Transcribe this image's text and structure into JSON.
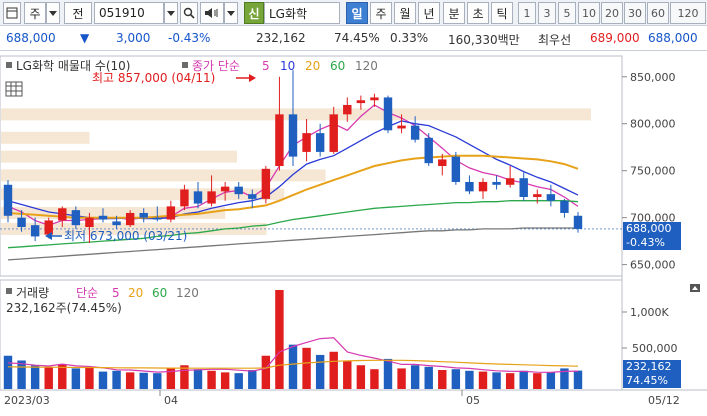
{
  "toolbar": {
    "chart_type": "주",
    "prev_label": "전",
    "code": "051910",
    "new_badge": "신",
    "stock_name": "LG화학",
    "periods": [
      "일",
      "주",
      "월",
      "년",
      "분",
      "초",
      "틱"
    ],
    "selected_period": "일",
    "intervals": [
      "1",
      "3",
      "5",
      "10",
      "20",
      "30",
      "60",
      "120"
    ]
  },
  "quote": {
    "price": "688,000",
    "direction": "▼",
    "change": "3,000",
    "change_pct": "-0.43%",
    "volume": "232,162",
    "volume_ratio": "74.45%",
    "turnover_pct": "0.33%",
    "amount": "160,330백만",
    "best_ask_label": "최우선",
    "ask": "689,000",
    "bid": "688,000"
  },
  "price_pane": {
    "title": "LG화학 매물대 수(10)",
    "ma_label": "종가 단순",
    "ma_periods": [
      "5",
      "10",
      "20",
      "60",
      "120"
    ],
    "ma_colors": [
      "#d63ab0",
      "#2a3ad6",
      "#e7a21a",
      "#2aa84a",
      "#777777"
    ],
    "high_note": "최고 857,000 (04/11)",
    "low_note": "최저 673,000 (03/21)",
    "y_ticks": [
      "850,000",
      "800,000",
      "750,000",
      "700,000",
      "650,000"
    ],
    "current_badge": "688,000",
    "current_pct": "-0.43%"
  },
  "volume_pane": {
    "title": "거래량",
    "ma_label": "단순",
    "ma_periods": [
      "5",
      "20",
      "60",
      "120"
    ],
    "ma_colors": [
      "#d63ab0",
      "#e7a21a",
      "#2aa84a",
      "#777777"
    ],
    "summary": "232,162주(74.45%)",
    "y_ticks": [
      "1,000K",
      "500,000"
    ],
    "current_badge": "232,162",
    "current_pct": "74.45%"
  },
  "dates": {
    "left": "2023/03",
    "mid1": "04",
    "mid2": "05",
    "right": "05/12"
  },
  "chart_data": {
    "type": "candlestick",
    "title": "LG화학",
    "price_ylim": [
      640000,
      870000
    ],
    "volume_ylim": [
      0,
      1250000
    ],
    "colors": {
      "up": "#e01e1e",
      "down": "#1f5fbf"
    },
    "candles": [
      {
        "date": "03/13",
        "open": 735000,
        "high": 740000,
        "low": 695000,
        "close": 702000,
        "volume": 420000
      },
      {
        "date": "03/14",
        "open": 700000,
        "high": 708000,
        "low": 685000,
        "close": 690000,
        "volume": 360000
      },
      {
        "date": "03/15",
        "open": 692000,
        "high": 700000,
        "low": 675000,
        "close": 680000,
        "volume": 300000
      },
      {
        "date": "03/16",
        "open": 682000,
        "high": 700000,
        "low": 678000,
        "close": 697000,
        "volume": 280000
      },
      {
        "date": "03/17",
        "open": 697000,
        "high": 712000,
        "low": 690000,
        "close": 710000,
        "volume": 310000
      },
      {
        "date": "03/20",
        "open": 708000,
        "high": 712000,
        "low": 688000,
        "close": 692000,
        "volume": 260000
      },
      {
        "date": "03/21",
        "open": 690000,
        "high": 705000,
        "low": 673000,
        "close": 700000,
        "volume": 270000
      },
      {
        "date": "03/22",
        "open": 702000,
        "high": 710000,
        "low": 695000,
        "close": 698000,
        "volume": 220000
      },
      {
        "date": "03/23",
        "open": 696000,
        "high": 702000,
        "low": 688000,
        "close": 692000,
        "volume": 230000
      },
      {
        "date": "03/24",
        "open": 692000,
        "high": 708000,
        "low": 690000,
        "close": 705000,
        "volume": 210000
      },
      {
        "date": "03/27",
        "open": 705000,
        "high": 710000,
        "low": 695000,
        "close": 700000,
        "volume": 205000
      },
      {
        "date": "03/28",
        "open": 700000,
        "high": 712000,
        "low": 696000,
        "close": 698000,
        "volume": 200000
      },
      {
        "date": "03/29",
        "open": 698000,
        "high": 718000,
        "low": 695000,
        "close": 712000,
        "volume": 260000
      },
      {
        "date": "03/30",
        "open": 712000,
        "high": 735000,
        "low": 708000,
        "close": 730000,
        "volume": 300000
      },
      {
        "date": "03/31",
        "open": 728000,
        "high": 738000,
        "low": 710000,
        "close": 715000,
        "volume": 250000
      },
      {
        "date": "04/03",
        "open": 715000,
        "high": 745000,
        "low": 712000,
        "close": 728000,
        "volume": 230000
      },
      {
        "date": "04/04",
        "open": 728000,
        "high": 738000,
        "low": 718000,
        "close": 733000,
        "volume": 210000
      },
      {
        "date": "04/05",
        "open": 733000,
        "high": 738000,
        "low": 720000,
        "close": 725000,
        "volume": 200000
      },
      {
        "date": "04/06",
        "open": 725000,
        "high": 730000,
        "low": 710000,
        "close": 720000,
        "volume": 240000
      },
      {
        "date": "04/07",
        "open": 720000,
        "high": 755000,
        "low": 715000,
        "close": 752000,
        "volume": 420000
      },
      {
        "date": "04/10",
        "open": 755000,
        "high": 850000,
        "low": 750000,
        "close": 810000,
        "volume": 1250000
      },
      {
        "date": "04/11",
        "open": 810000,
        "high": 857000,
        "low": 755000,
        "close": 765000,
        "volume": 560000
      },
      {
        "date": "04/12",
        "open": 770000,
        "high": 805000,
        "low": 760000,
        "close": 790000,
        "volume": 520000
      },
      {
        "date": "04/13",
        "open": 790000,
        "high": 800000,
        "low": 765000,
        "close": 770000,
        "volume": 430000
      },
      {
        "date": "04/14",
        "open": 770000,
        "high": 818000,
        "low": 768000,
        "close": 810000,
        "volume": 470000
      },
      {
        "date": "04/17",
        "open": 810000,
        "high": 828000,
        "low": 802000,
        "close": 820000,
        "volume": 360000
      },
      {
        "date": "04/18",
        "open": 822000,
        "high": 830000,
        "low": 815000,
        "close": 825000,
        "volume": 300000
      },
      {
        "date": "04/19",
        "open": 825000,
        "high": 832000,
        "low": 818000,
        "close": 828000,
        "volume": 250000
      },
      {
        "date": "04/20",
        "open": 828000,
        "high": 830000,
        "low": 790000,
        "close": 793000,
        "volume": 380000
      },
      {
        "date": "04/21",
        "open": 795000,
        "high": 810000,
        "low": 790000,
        "close": 798000,
        "volume": 260000
      },
      {
        "date": "04/24",
        "open": 798000,
        "high": 808000,
        "low": 780000,
        "close": 783000,
        "volume": 300000
      },
      {
        "date": "04/25",
        "open": 785000,
        "high": 790000,
        "low": 755000,
        "close": 758000,
        "volume": 280000
      },
      {
        "date": "04/26",
        "open": 755000,
        "high": 768000,
        "low": 745000,
        "close": 762000,
        "volume": 240000
      },
      {
        "date": "04/27",
        "open": 765000,
        "high": 770000,
        "low": 735000,
        "close": 738000,
        "volume": 250000
      },
      {
        "date": "04/28",
        "open": 738000,
        "high": 745000,
        "low": 725000,
        "close": 728000,
        "volume": 230000
      },
      {
        "date": "05/02",
        "open": 728000,
        "high": 742000,
        "low": 720000,
        "close": 738000,
        "volume": 220000
      },
      {
        "date": "05/03",
        "open": 738000,
        "high": 745000,
        "low": 730000,
        "close": 735000,
        "volume": 210000
      },
      {
        "date": "05/04",
        "open": 735000,
        "high": 755000,
        "low": 732000,
        "close": 742000,
        "volume": 200000
      },
      {
        "date": "05/08",
        "open": 742000,
        "high": 748000,
        "low": 718000,
        "close": 722000,
        "volume": 230000
      },
      {
        "date": "05/09",
        "open": 722000,
        "high": 730000,
        "low": 715000,
        "close": 725000,
        "volume": 200000
      },
      {
        "date": "05/10",
        "open": 725000,
        "high": 735000,
        "low": 712000,
        "close": 718000,
        "volume": 210000
      },
      {
        "date": "05/11",
        "open": 718000,
        "high": 720000,
        "low": 700000,
        "close": 705000,
        "volume": 260000
      },
      {
        "date": "05/12",
        "open": 702000,
        "high": 706000,
        "low": 684000,
        "close": 688000,
        "volume": 232162
      }
    ],
    "moving_averages": {
      "5": [
        712000,
        706000,
        697000,
        692000,
        697000,
        697000,
        698000,
        699000,
        700000,
        698000,
        700000,
        700000,
        701000,
        710000,
        712000,
        720000,
        727000,
        729000,
        722000,
        732000,
        755000,
        777000,
        786000,
        794000,
        800000,
        793000,
        808000,
        820000,
        812000,
        806000,
        798000,
        786000,
        774000,
        761000,
        753000,
        748000,
        745000,
        740000,
        737000,
        733000,
        730000,
        722000,
        712000
      ],
      "10": [
        718000,
        714000,
        710000,
        706000,
        704000,
        702000,
        700000,
        699000,
        699000,
        700000,
        699000,
        699000,
        700000,
        704000,
        706000,
        710000,
        713000,
        716000,
        718000,
        722000,
        733000,
        746000,
        757000,
        762000,
        766000,
        774000,
        782000,
        790000,
        797000,
        803000,
        800000,
        798000,
        792000,
        786000,
        778000,
        770000,
        762000,
        756000,
        749000,
        743000,
        738000,
        731000,
        724000
      ],
      "20": [
        705000,
        704000,
        703000,
        702000,
        701000,
        700000,
        700000,
        700000,
        700000,
        700000,
        700000,
        701000,
        702000,
        703000,
        704000,
        706000,
        708000,
        709000,
        711000,
        713000,
        718000,
        724000,
        730000,
        735000,
        740000,
        745000,
        750000,
        755000,
        758000,
        761000,
        763000,
        764000,
        765000,
        766000,
        766000,
        766000,
        765000,
        764000,
        763000,
        762000,
        760000,
        757000,
        752000
      ],
      "60": [
        668000,
        669000,
        670000,
        671000,
        672000,
        673000,
        674000,
        675000,
        676000,
        677000,
        678000,
        680000,
        681000,
        683000,
        684000,
        686000,
        688000,
        689000,
        691000,
        692000,
        695000,
        698000,
        700000,
        702000,
        704000,
        706000,
        708000,
        710000,
        711000,
        712000,
        713000,
        714000,
        715000,
        716000,
        716000,
        717000,
        717000,
        718000,
        718000,
        718000,
        718000,
        718000,
        717000
      ],
      "120": [
        655000,
        656000,
        657000,
        658000,
        659000,
        660000,
        661000,
        662000,
        663000,
        664000,
        665000,
        666000,
        667000,
        668000,
        669000,
        670000,
        671000,
        672000,
        673000,
        674000,
        675000,
        676000,
        677000,
        678000,
        679000,
        680000,
        681000,
        682000,
        683000,
        684000,
        685000,
        686000,
        686000,
        687000,
        687000,
        688000,
        688000,
        688000,
        689000,
        689000,
        689000,
        689000,
        689000
      ]
    },
    "volume_ma5": [
      330000,
      320000,
      300000,
      290000,
      314000,
      292000,
      284000,
      268000,
      242000,
      240000,
      227000,
      213000,
      221000,
      235000,
      243000,
      249000,
      250000,
      238000,
      226000,
      260000,
      466000,
      536000,
      588000,
      636000,
      646000,
      468000,
      424000,
      390000,
      352000,
      310000,
      310000,
      296000,
      284000,
      266000,
      260000,
      244000,
      230000,
      224000,
      222000,
      212000,
      210000,
      222000,
      226000
    ],
    "volume_ma20": [
      280000,
      278000,
      276000,
      275000,
      274000,
      272000,
      271000,
      270000,
      268000,
      267000,
      266000,
      265000,
      264000,
      264000,
      263000,
      263000,
      262000,
      262000,
      262000,
      265000,
      300000,
      315000,
      330000,
      340000,
      350000,
      355000,
      360000,
      362000,
      363000,
      362000,
      358000,
      352000,
      345000,
      338000,
      330000,
      322000,
      316000,
      310000,
      305000,
      300000,
      295000,
      292000,
      288000
    ],
    "volume_profile": [
      {
        "price": 810000,
        "weight": 1.0
      },
      {
        "price": 785000,
        "weight": 0.15
      },
      {
        "price": 765000,
        "weight": 0.4
      },
      {
        "price": 745000,
        "weight": 0.55
      },
      {
        "price": 725000,
        "weight": 0.48
      },
      {
        "price": 705000,
        "weight": 0.38
      },
      {
        "price": 688000,
        "weight": 0.45
      }
    ]
  }
}
